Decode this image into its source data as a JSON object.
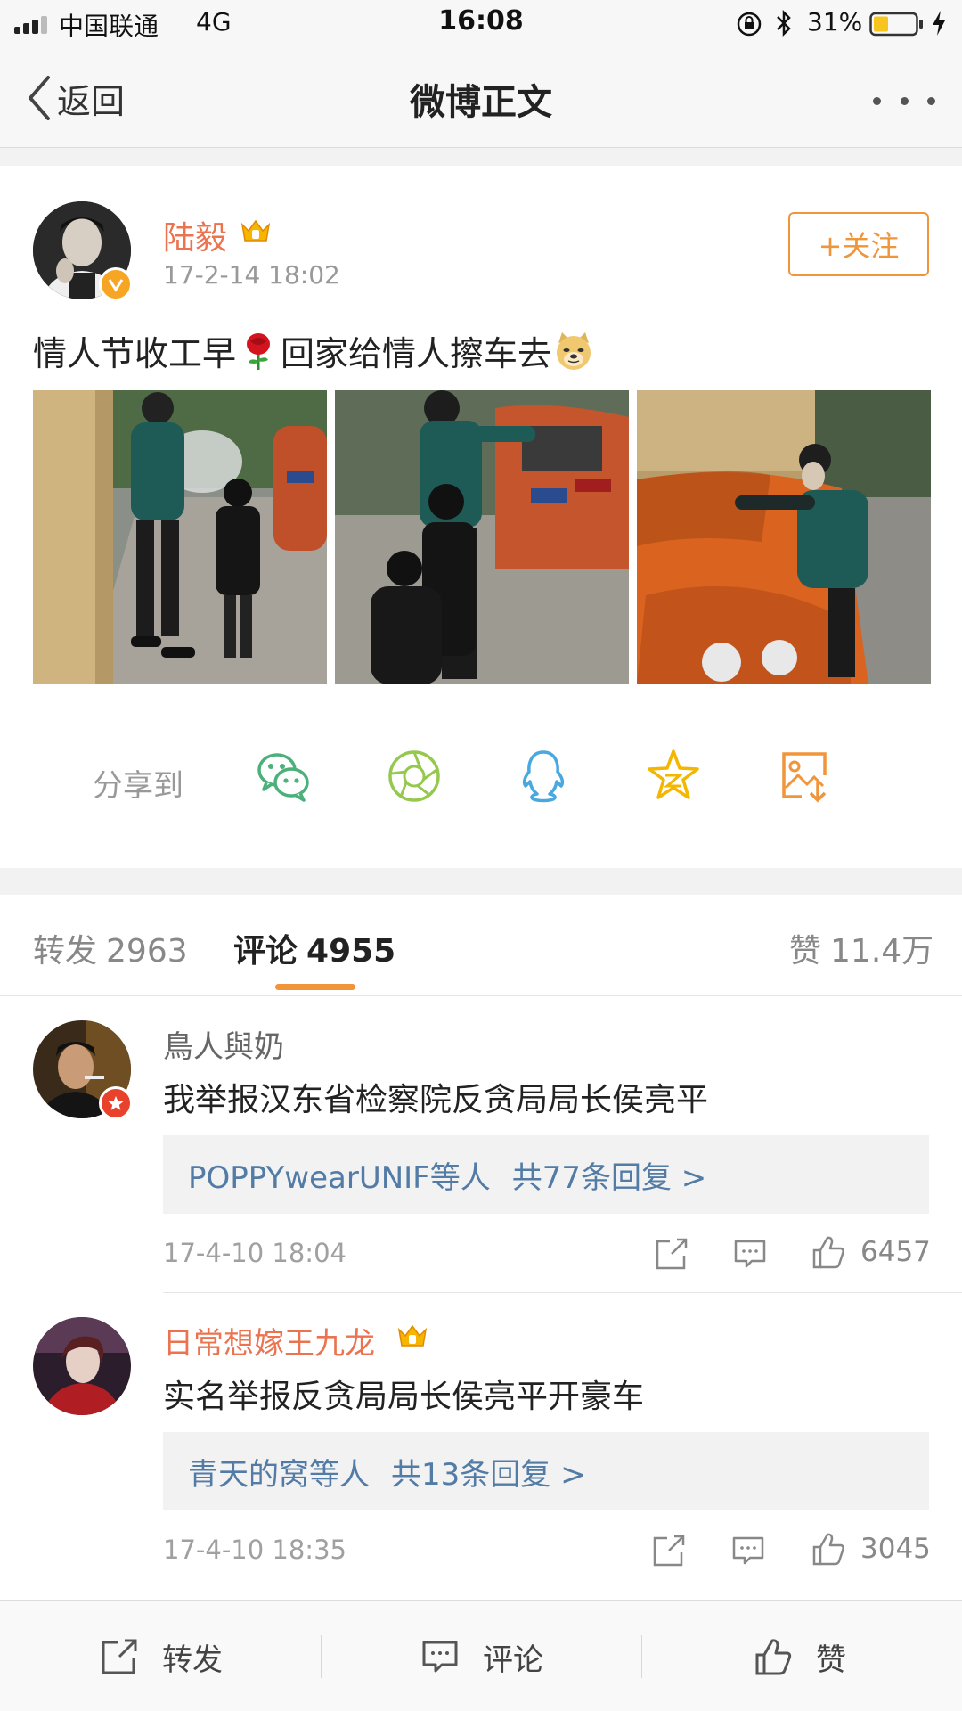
{
  "status_bar": {
    "carrier": "中国联通",
    "network": "4G",
    "time": "16:08",
    "battery": "31%"
  },
  "nav": {
    "back_label": "返回",
    "title": "微博正文"
  },
  "post": {
    "author": "陆毅",
    "time": "17-2-14 18:02",
    "follow_label": "+关注",
    "text_part1": "情人节收工早",
    "text_part2": "回家给情人擦车去",
    "emoji_1": "rose-emoji",
    "emoji_2": "doge-emoji",
    "photo_count": 3
  },
  "share": {
    "label": "分享到",
    "targets": [
      "wechat-icon",
      "moments-icon",
      "qq-icon",
      "qzone-icon",
      "save-image-icon"
    ]
  },
  "tabs": {
    "repost_label": "转发",
    "repost_count": "2963",
    "comment_label": "评论",
    "comment_count": "4955",
    "like_label": "赞",
    "like_count": "11.4万"
  },
  "comments": [
    {
      "name": "鳥人與奶",
      "text": "我举报汉东省检察院反贪局局长侯亮平",
      "replies_users": "POPPYwearUNIF等人",
      "replies_count": "共77条回复 >",
      "time": "17-4-10 18:04",
      "likes": "6457"
    },
    {
      "name": "日常想嫁王九龙",
      "text": "实名举报反贪局局长侯亮平开豪车",
      "replies_users": "青天的窝等人",
      "replies_count": "共13条回复 >",
      "time": "17-4-10 18:35",
      "likes": "3045"
    }
  ],
  "toolbar": {
    "repost_label": "转发",
    "comment_label": "评论",
    "like_label": "赞"
  },
  "colors": {
    "accent": "#f0953a",
    "username_orange": "#eb7350",
    "link_blue": "#527ba6"
  }
}
